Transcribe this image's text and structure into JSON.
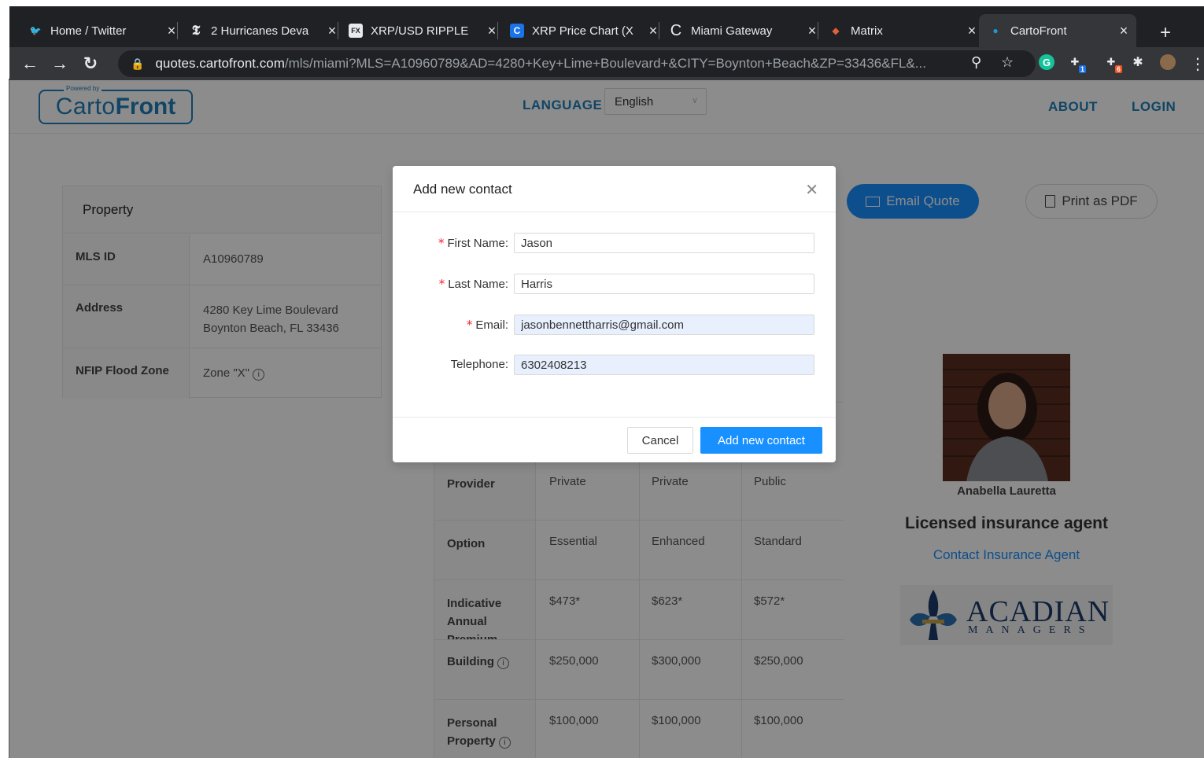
{
  "browser": {
    "tabs": [
      {
        "title": "Home / Twitter",
        "icon": "twitter-bird-icon",
        "icon_glyph": "🐦",
        "icon_color": "#1da1f2"
      },
      {
        "title": "2 Hurricanes Deva",
        "icon": "nyt-logo-icon",
        "icon_glyph": "𝕿",
        "icon_color": "#e8eaed"
      },
      {
        "title": "XRP/USD RIPPLE",
        "icon": "fx-logo-icon",
        "icon_glyph": "FX",
        "icon_color": "#e8eaed"
      },
      {
        "title": "XRP Price Chart (X",
        "icon": "coin-logo-icon",
        "icon_glyph": "C",
        "icon_color": "#1a73e8"
      },
      {
        "title": "Miami Gateway",
        "icon": "c-logo-icon",
        "icon_glyph": "C",
        "icon_color": "#e8eaed"
      },
      {
        "title": "Matrix",
        "icon": "matrix-logo-icon",
        "icon_glyph": "◆",
        "icon_color": "#e0603a"
      },
      {
        "title": "CartoFront",
        "icon": "cartofront-logo-icon",
        "icon_glyph": "●",
        "icon_color": "#1a9bd7"
      }
    ],
    "url_domain": "quotes.cartofront.com",
    "url_path": "/mls/miami?MLS=A10960789&AD=4280+Key+Lime+Boulevard+&CITY=Boynton+Beach&ZP=33436&FL&...",
    "extension_badges": [
      "1",
      "6"
    ]
  },
  "header": {
    "logo_powered": "Powered by",
    "logo_text_a": "Carto",
    "logo_text_b": "Front",
    "language_label": "LANGUAGE",
    "language_value": "English",
    "about": "ABOUT",
    "login": "LOGIN"
  },
  "property": {
    "title": "Property",
    "rows": [
      {
        "key": "MLS ID",
        "value": "A10960789"
      },
      {
        "key": "Address",
        "value_line1": "4280 Key Lime Boulevard",
        "value_line2": "Boynton Beach, FL 33436"
      },
      {
        "key": "NFIP Flood Zone",
        "value": "Zone \"X\""
      }
    ]
  },
  "actions": {
    "email_quote": "Email Quote",
    "print_pdf": "Print as PDF"
  },
  "quotes": {
    "rows": [
      {
        "key": "Provider",
        "c1": "Private",
        "c2": "Private",
        "c3": "Public"
      },
      {
        "key": "Option",
        "c1": "Essential",
        "c2": "Enhanced",
        "c3": "Standard"
      },
      {
        "key_line1": "Indicative",
        "key_line2": "Annual",
        "key_line3": "Premium",
        "c1": "$473*",
        "c2": "$623*",
        "c3": "$572*"
      },
      {
        "key": "Building",
        "c1": "$250,000",
        "c2": "$300,000",
        "c3": "$250,000"
      },
      {
        "key_line1": "Personal",
        "key_line2": "Property",
        "c1": "$100,000",
        "c2": "$100,000",
        "c3": "$100,000"
      }
    ]
  },
  "agent": {
    "name": "Anabella Lauretta",
    "title": "Licensed insurance agent",
    "contact_link": "Contact Insurance Agent",
    "company_big": "ACADIAN",
    "company_small": "MANAGERS"
  },
  "modal": {
    "title": "Add new contact",
    "fields": {
      "first_name": {
        "label": "First Name",
        "value": "Jason"
      },
      "last_name": {
        "label": "Last Name",
        "value": "Harris"
      },
      "email": {
        "label": "Email",
        "value": "jasonbennettharris@gmail.com"
      },
      "telephone": {
        "label": "Telephone",
        "value": "6302408213"
      }
    },
    "cancel": "Cancel",
    "submit": "Add new contact"
  },
  "colors": {
    "primary": "#1890ff",
    "brand": "#1f7fb8",
    "required": "#f5222d"
  }
}
